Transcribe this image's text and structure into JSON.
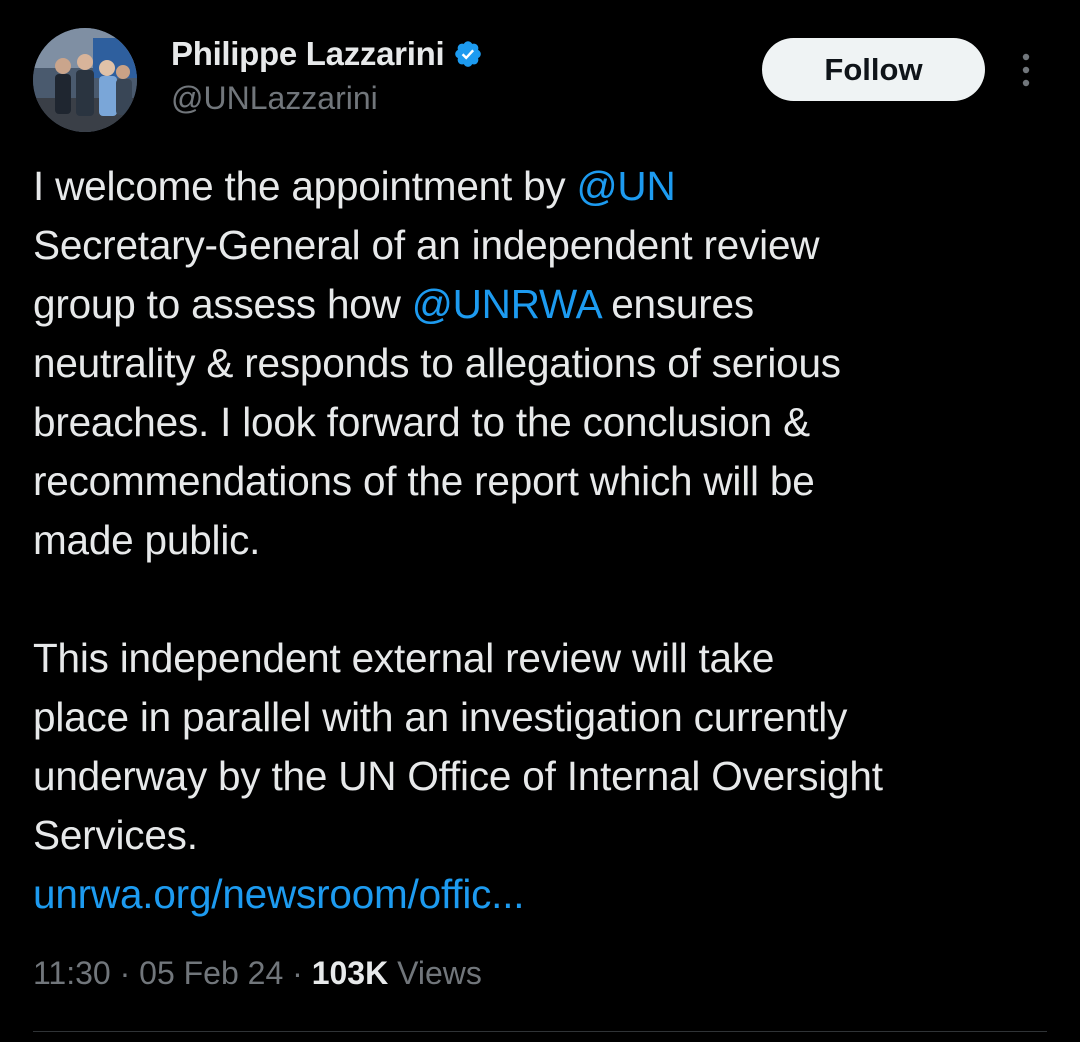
{
  "author": {
    "display_name": "Philippe Lazzarini",
    "handle": "@UNLazzarini",
    "verified_icon": "verified-badge-icon"
  },
  "header": {
    "follow_label": "Follow",
    "more_icon": "more-options-icon"
  },
  "tweet": {
    "p1_line1_pre": "I welcome the appointment by ",
    "p1_mention1": "@UN",
    "p1_line2": "Secretary-General of an independent review",
    "p1_line3_pre": "group to assess how ",
    "p1_mention2": "@UNRWA",
    "p1_line3_post": " ensures",
    "p1_line4": "neutrality & responds to allegations of serious",
    "p1_line5": "breaches. I look forward to the conclusion &",
    "p1_line6": "recommendations of the report which will be",
    "p1_line7": "made public.",
    "p2_line1": "This independent external review will take",
    "p2_line2": "place in parallel with an investigation currently",
    "p2_line3": "underway by the UN Office of Internal Oversight",
    "p2_line4": "Services.",
    "link_text": "unrwa.org/newsroom/offic..."
  },
  "meta": {
    "time": "11:30",
    "sep1": " · ",
    "date": "05 Feb 24",
    "sep2": " · ",
    "views_count": "103K",
    "views_label": " Views"
  },
  "colors": {
    "background": "#000000",
    "text": "#e7e9ea",
    "secondary": "#71767b",
    "accent": "#1d9bf0",
    "button_bg": "#eff3f4"
  }
}
